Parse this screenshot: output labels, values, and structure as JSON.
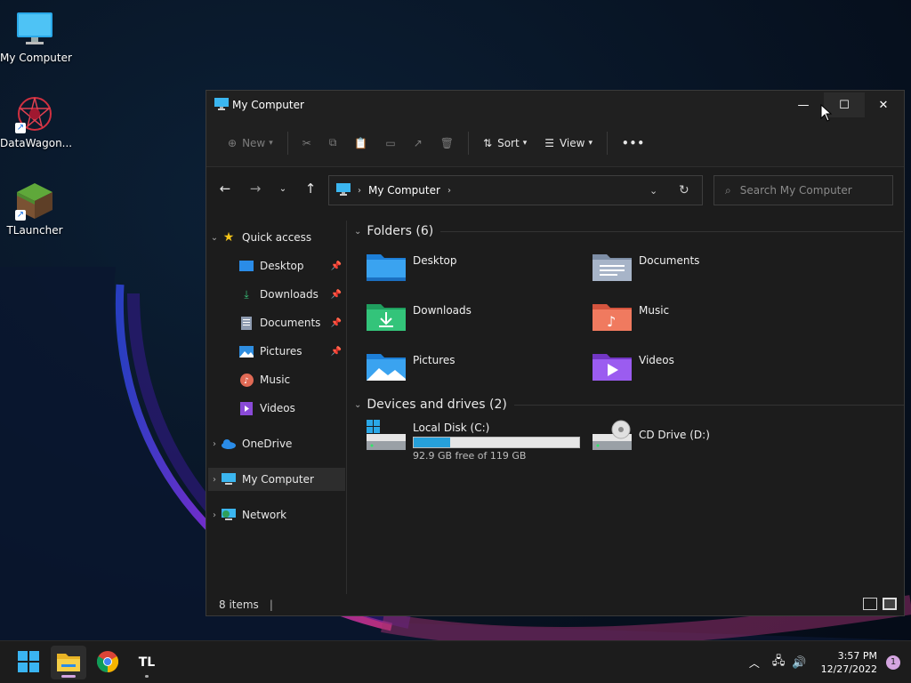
{
  "desktop": {
    "icons": [
      {
        "label": "My Computer",
        "icon": "monitor-icon"
      },
      {
        "label": "DataWagon...",
        "icon": "datawagon-icon"
      },
      {
        "label": "TLauncher",
        "icon": "grass-block-icon"
      }
    ]
  },
  "window": {
    "title": "My Computer",
    "controls": {
      "minimize": "—",
      "maximize": "☐",
      "close": "✕"
    }
  },
  "toolbar": {
    "new_label": "New",
    "sort_label": "Sort",
    "view_label": "View",
    "more_label": "•••"
  },
  "address": {
    "path": "My Computer",
    "search_placeholder": "Search My Computer"
  },
  "sidebar": {
    "quick_access": "Quick access",
    "items": [
      {
        "label": "Desktop",
        "pinned": true
      },
      {
        "label": "Downloads",
        "pinned": true
      },
      {
        "label": "Documents",
        "pinned": true
      },
      {
        "label": "Pictures",
        "pinned": true
      },
      {
        "label": "Music",
        "pinned": false
      },
      {
        "label": "Videos",
        "pinned": false
      }
    ],
    "onedrive": "OneDrive",
    "my_computer": "My Computer",
    "network": "Network"
  },
  "content": {
    "folders_header": "Folders (6)",
    "folders": [
      "Desktop",
      "Documents",
      "Downloads",
      "Music",
      "Pictures",
      "Videos"
    ],
    "drives_header": "Devices and drives (2)",
    "drives": [
      {
        "name": "Local Disk (C:)",
        "free_text": "92.9 GB free of 119 GB",
        "used_fraction": 0.22
      },
      {
        "name": "CD Drive (D:)"
      }
    ]
  },
  "status": {
    "items_count": "8 items"
  },
  "taskbar": {
    "time": "3:57 PM",
    "date": "12/27/2022",
    "notification_count": "1",
    "apps": [
      "start-icon",
      "file-explorer-icon",
      "chrome-icon",
      "tlauncher-icon"
    ]
  },
  "colors": {
    "accent": "#0078d4",
    "drive_bar": "#26a0da",
    "window_bg": "#1c1c1c"
  }
}
